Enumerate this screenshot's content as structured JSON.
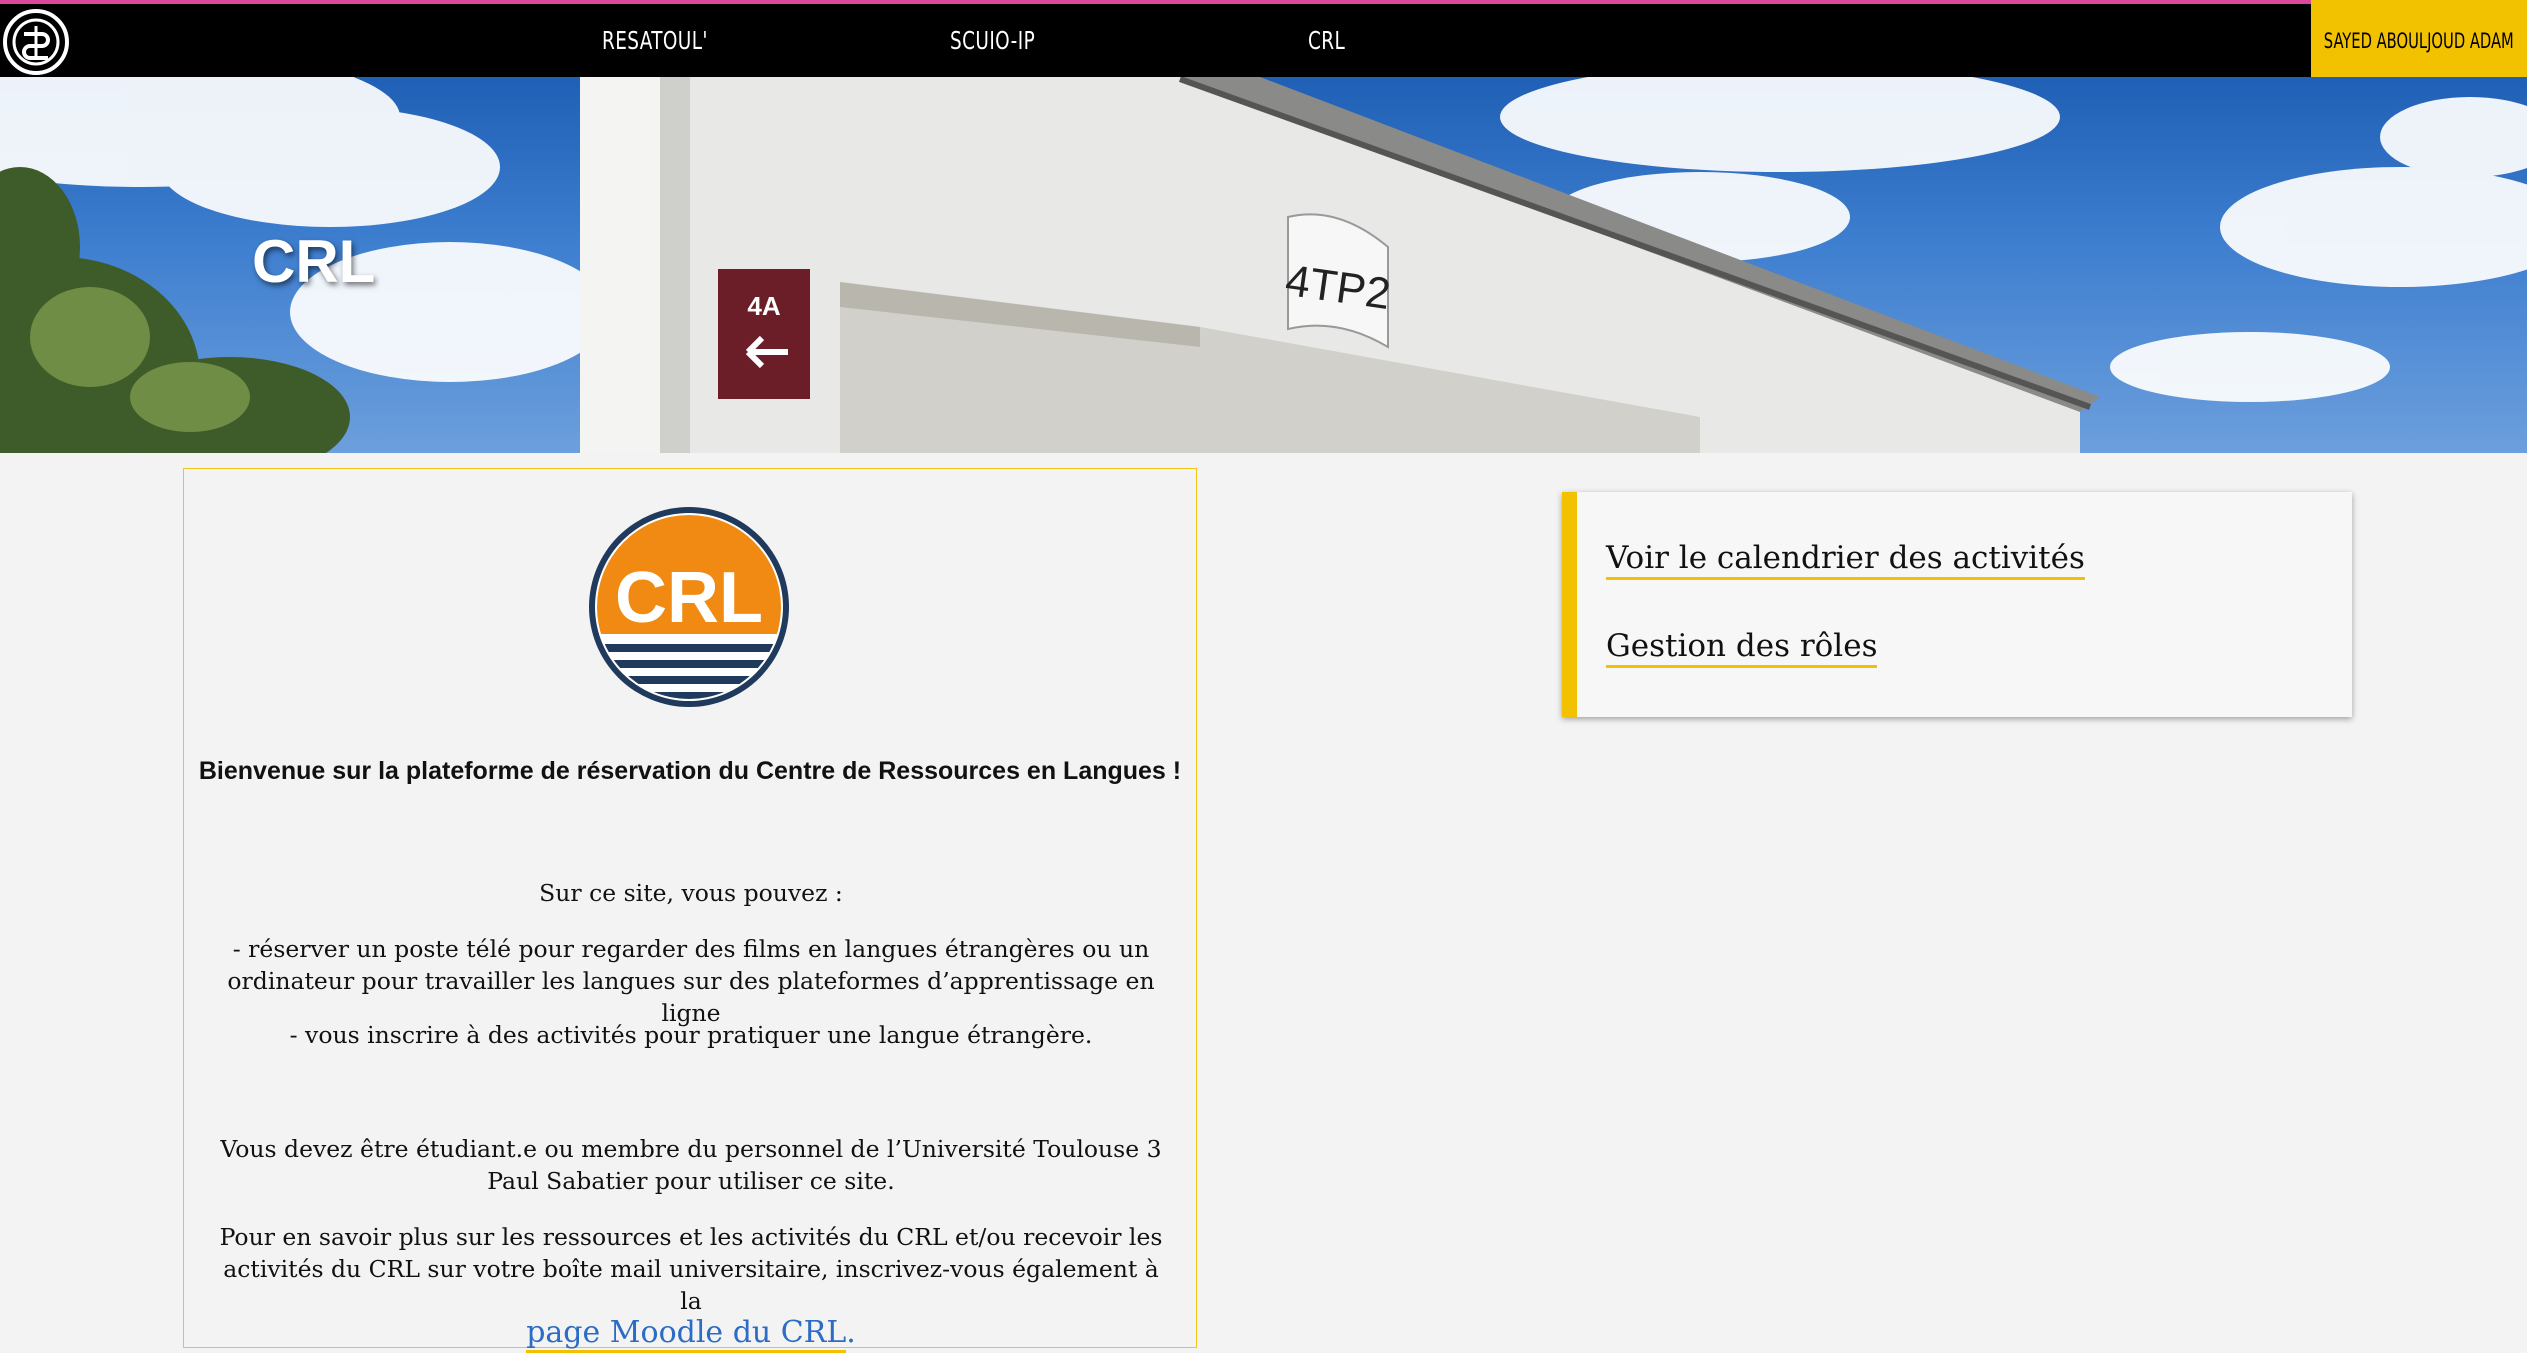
{
  "nav": {
    "logo_icon": "university-logo-icon",
    "links": [
      "RESATOUL'",
      "SCUIO-IP",
      "CRL"
    ],
    "user": "SAYED ABOULJOUD ADAM",
    "accent": "#f2c200",
    "top_border": "#d9489a"
  },
  "hero": {
    "title": "CRL",
    "sign_building": "4TP2",
    "sign_direction": "4A"
  },
  "card": {
    "logo_text": "CRL",
    "welcome": "Bienvenue sur la plateforme de réservation du Centre de Ressources en Langues !",
    "intro": "Sur ce site, vous pouvez :",
    "item1": "- réserver un poste télé pour regarder des films en langues étrangères ou un ordinateur pour travailler les langues sur des plateformes d’apprentissage en ligne",
    "item2": "- vous inscrire à des activités pour pratiquer une langue étrangère.",
    "eligibility": "Vous devez être étudiant.e ou membre du personnel de l’Université Toulouse 3 Paul Sabatier pour utiliser ce site.",
    "more_info": "Pour en savoir plus sur les ressources et les activités du CRL et/ou recevoir les activités du CRL sur votre boîte mail universitaire, inscrivez-vous également à la",
    "moodle_link": "page Moodle du CRL",
    "moodle_suffix": "."
  },
  "side": {
    "links": [
      "Voir le calendrier des activités",
      "Gestion des rôles"
    ]
  }
}
